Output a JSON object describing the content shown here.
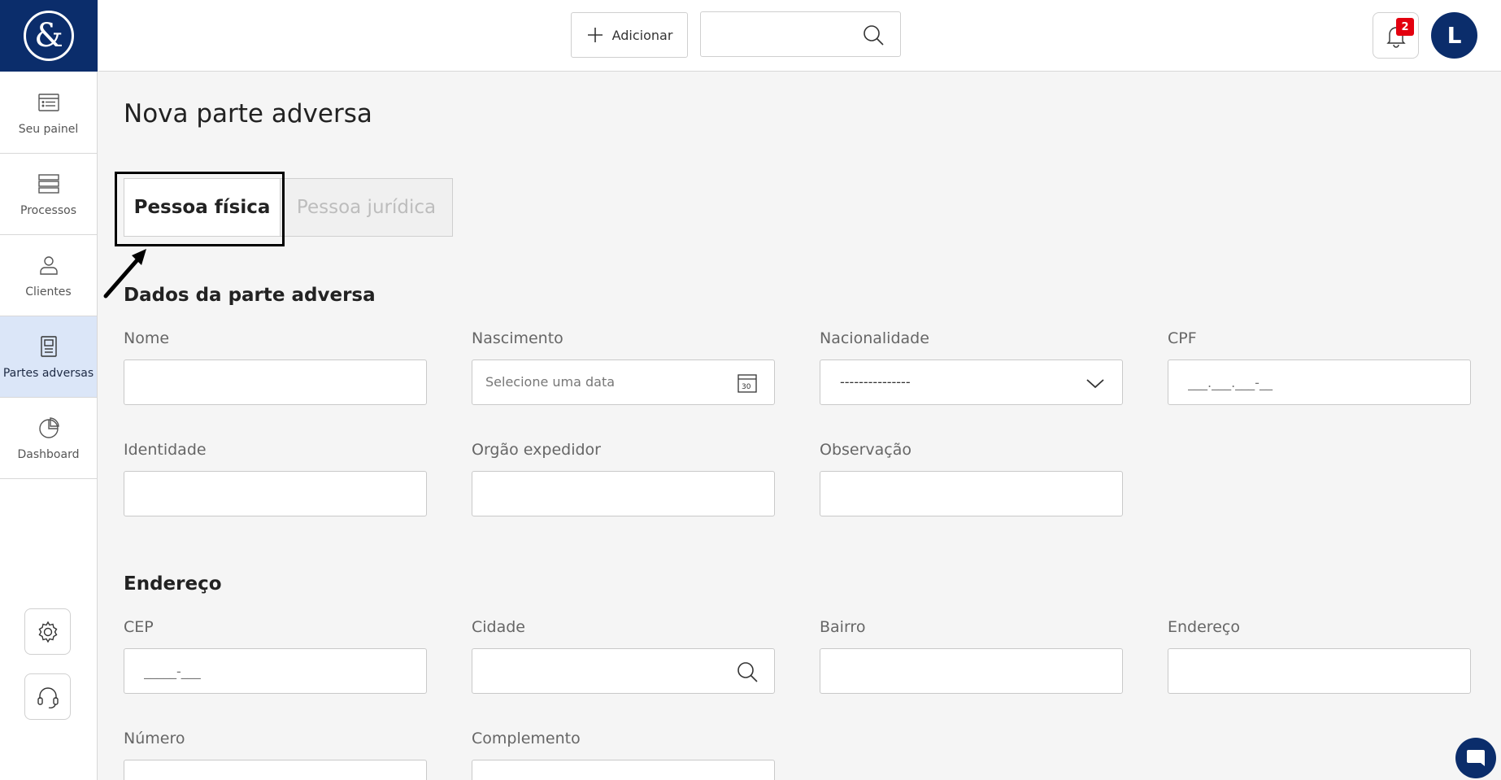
{
  "app": {
    "logo_text": "&",
    "brand_color": "#0b2d6b"
  },
  "sidebar": {
    "items": [
      {
        "label": "Seu painel",
        "icon": "list-panel-icon"
      },
      {
        "label": "Processos",
        "icon": "stack-icon"
      },
      {
        "label": "Clientes",
        "icon": "person-icon"
      },
      {
        "label": "Partes adversas",
        "icon": "document-icon",
        "active": true
      },
      {
        "label": "Dashboard",
        "icon": "pie-chart-icon"
      }
    ],
    "bottom_buttons": [
      {
        "icon": "settings-gear-icon"
      },
      {
        "icon": "headset-support-icon"
      }
    ]
  },
  "header": {
    "add_label": "Adicionar",
    "search_placeholder": "",
    "notification_count": "2",
    "avatar_initial": "L"
  },
  "page": {
    "title": "Nova parte adversa",
    "tabs": [
      {
        "label": "Pessoa física",
        "active": true
      },
      {
        "label": "Pessoa jurídica",
        "active": false
      }
    ]
  },
  "sections": {
    "dados": {
      "title": "Dados da parte adversa",
      "nome": {
        "label": "Nome",
        "value": ""
      },
      "nascimento": {
        "label": "Nascimento",
        "placeholder": "Selecione uma data"
      },
      "nacionalidade": {
        "label": "Nacionalidade",
        "value": "---------------"
      },
      "cpf": {
        "label": "CPF",
        "placeholder": "___.___.___-__"
      },
      "identidade": {
        "label": "Identidade",
        "value": ""
      },
      "orgao": {
        "label": "Orgão expedidor",
        "value": ""
      },
      "observacao": {
        "label": "Observação",
        "value": ""
      }
    },
    "endereco": {
      "title": "Endereço",
      "cep": {
        "label": "CEP",
        "placeholder": "_____-___"
      },
      "cidade": {
        "label": "Cidade",
        "value": ""
      },
      "bairro": {
        "label": "Bairro",
        "value": ""
      },
      "endereco": {
        "label": "Endereço",
        "value": ""
      },
      "numero": {
        "label": "Número",
        "value": ""
      },
      "complemento": {
        "label": "Complemento",
        "value": ""
      }
    }
  }
}
